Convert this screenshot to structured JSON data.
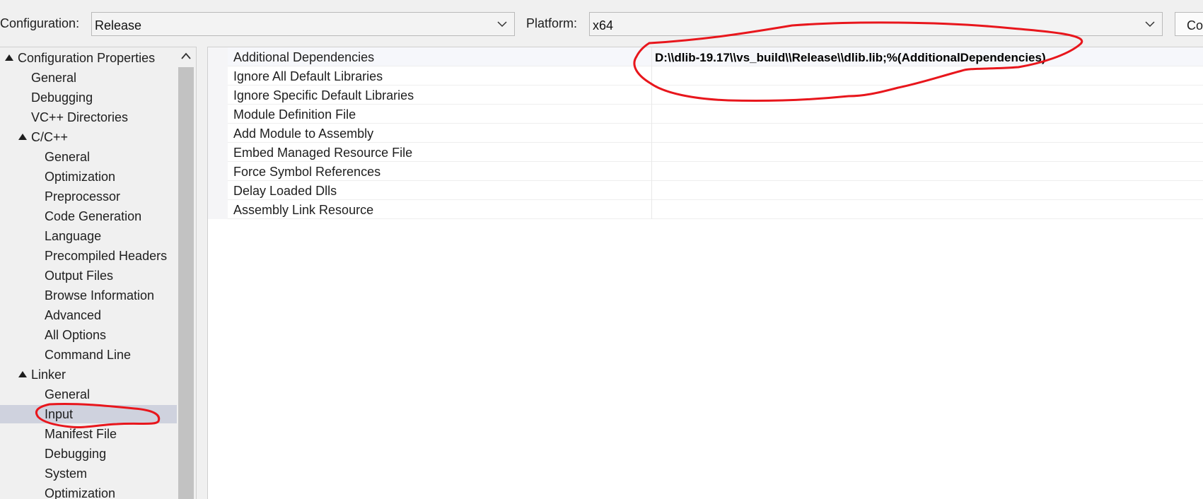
{
  "toolbar": {
    "configuration_label": "Configuration:",
    "configuration_value": "Release",
    "platform_label": "Platform:",
    "platform_value": "x64",
    "button_label": "Co"
  },
  "tree": {
    "root": "Configuration Properties",
    "items": [
      {
        "label": "General"
      },
      {
        "label": "Debugging"
      },
      {
        "label": "VC++ Directories"
      },
      {
        "label": "C/C++"
      },
      {
        "label": "General"
      },
      {
        "label": "Optimization"
      },
      {
        "label": "Preprocessor"
      },
      {
        "label": "Code Generation"
      },
      {
        "label": "Language"
      },
      {
        "label": "Precompiled Headers"
      },
      {
        "label": "Output Files"
      },
      {
        "label": "Browse Information"
      },
      {
        "label": "Advanced"
      },
      {
        "label": "All Options"
      },
      {
        "label": "Command Line"
      },
      {
        "label": "Linker"
      },
      {
        "label": "General"
      },
      {
        "label": "Input"
      },
      {
        "label": "Manifest File"
      },
      {
        "label": "Debugging"
      },
      {
        "label": "System"
      },
      {
        "label": "Optimization"
      }
    ]
  },
  "grid": {
    "rows": [
      {
        "name": "Additional Dependencies",
        "value": "D:\\\\dlib-19.17\\\\vs_build\\\\Release\\\\dlib.lib;%(AdditionalDependencies)"
      },
      {
        "name": "Ignore All Default Libraries",
        "value": ""
      },
      {
        "name": "Ignore Specific Default Libraries",
        "value": ""
      },
      {
        "name": "Module Definition File",
        "value": ""
      },
      {
        "name": "Add Module to Assembly",
        "value": ""
      },
      {
        "name": "Embed Managed Resource File",
        "value": ""
      },
      {
        "name": "Force Symbol References",
        "value": ""
      },
      {
        "name": "Delay Loaded Dlls",
        "value": ""
      },
      {
        "name": "Assembly Link Resource",
        "value": ""
      }
    ]
  },
  "colors": {
    "annotation": "#e8161c",
    "selection": "#cfd2de"
  }
}
